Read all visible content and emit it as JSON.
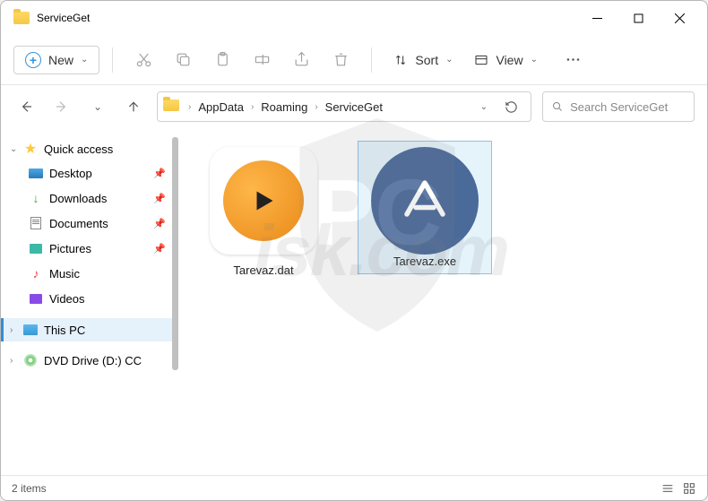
{
  "window": {
    "title": "ServiceGet"
  },
  "toolbar": {
    "new_label": "New",
    "sort_label": "Sort",
    "view_label": "View"
  },
  "breadcrumb": {
    "items": [
      "AppData",
      "Roaming",
      "ServiceGet"
    ]
  },
  "search": {
    "placeholder": "Search ServiceGet"
  },
  "sidebar": {
    "quick_access": "Quick access",
    "items": [
      {
        "label": "Desktop",
        "pinned": true
      },
      {
        "label": "Downloads",
        "pinned": true
      },
      {
        "label": "Documents",
        "pinned": true
      },
      {
        "label": "Pictures",
        "pinned": true
      },
      {
        "label": "Music",
        "pinned": false
      },
      {
        "label": "Videos",
        "pinned": false
      }
    ],
    "this_pc": "This PC",
    "dvd": "DVD Drive (D:) CC"
  },
  "files": [
    {
      "name": "Tarevaz.dat",
      "selected": false
    },
    {
      "name": "Tarevaz.exe",
      "selected": true
    }
  ],
  "status": {
    "count_text": "2 items"
  },
  "watermark": "isk.com"
}
